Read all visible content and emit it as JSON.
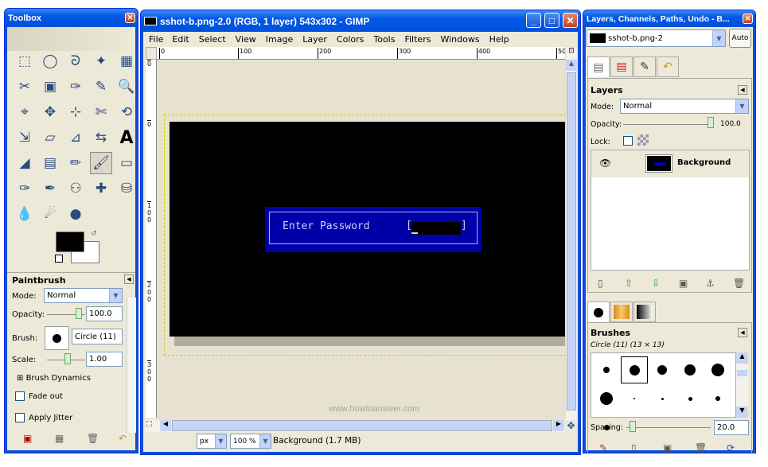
{
  "toolbox": {
    "title": "Toolbox",
    "options_title": "Paintbrush",
    "mode_label": "Mode:",
    "mode_value": "Normal",
    "opacity_label": "Opacity:",
    "opacity_value": "100.0",
    "brush_label": "Brush:",
    "brush_value": "Circle (11)",
    "scale_label": "Scale:",
    "scale_value": "1.00",
    "dynamics_label": "Brush Dynamics",
    "fadeout_label": "Fade out",
    "jitter_label": "Apply Jitter"
  },
  "image_window": {
    "title": "sshot-b.png-2.0 (RGB, 1 layer) 543x302 - GIMP",
    "menu": [
      "File",
      "Edit",
      "Select",
      "View",
      "Image",
      "Layer",
      "Colors",
      "Tools",
      "Filters",
      "Windows",
      "Help"
    ],
    "ruler_h": [
      "0",
      "100",
      "200",
      "300",
      "400",
      "50"
    ],
    "ruler_v": [
      "0",
      "0",
      "1\n0\n0",
      "2\n0\n0",
      "3\n0\n0"
    ],
    "canvas_prompt": "Enter Password",
    "canvas_bracket_l": "[",
    "canvas_bracket_r": "]",
    "watermark": "www.howtoanswer.com",
    "unit": "px",
    "zoom": "100 %",
    "status": "Background (1.7 MB)"
  },
  "layers_window": {
    "title": "Layers, Channels, Paths, Undo - B...",
    "image_select": "sshot-b.png-2",
    "auto_label": "Auto",
    "layers_title": "Layers",
    "mode_label": "Mode:",
    "mode_value": "Normal",
    "opacity_label": "Opacity:",
    "opacity_value": "100.0",
    "lock_label": "Lock:",
    "layer_name": "Background",
    "brushes_title": "Brushes",
    "brush_info": "Circle (11) (13 × 13)",
    "spacing_label": "Spacing:",
    "spacing_value": "20.0"
  },
  "colors": {
    "xp_blue": "#0a50d8",
    "canvas_black": "#000000",
    "dialog_blue": "#0000a8"
  }
}
